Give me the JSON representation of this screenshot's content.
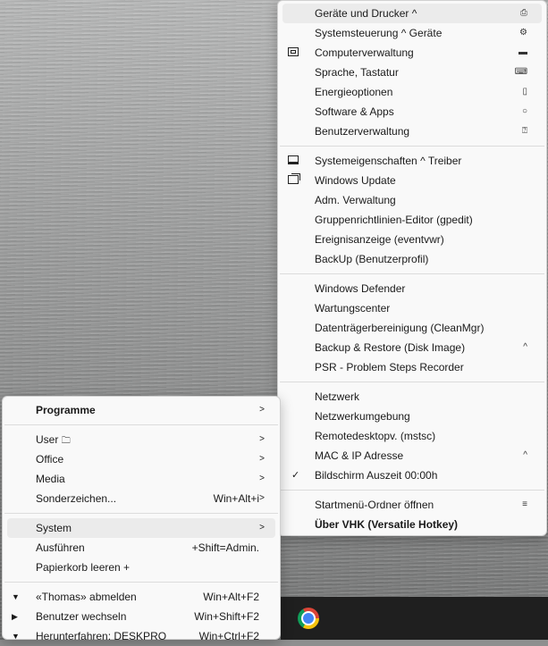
{
  "right_menu": {
    "group1": [
      {
        "label": "Geräte und Drucker ^",
        "icon": "printer-icon",
        "highlighted": true
      },
      {
        "label": "Systemsteuerung ^ Geräte",
        "icon": "gear-icon"
      },
      {
        "label": "Computerverwaltung",
        "icon": "computer-icon",
        "left_icon": "window-icon"
      },
      {
        "label": "Sprache, Tastatur",
        "icon": "keyboard-icon"
      },
      {
        "label": "Energieoptionen",
        "icon": "battery-icon"
      },
      {
        "label": "Software & Apps",
        "icon": "circle-icon"
      },
      {
        "label": "Benutzerverwaltung",
        "icon": "user-card-icon"
      }
    ],
    "group2": [
      {
        "label": "Systemeigenschaften ^ Treiber",
        "left_icon": "minimized-window-icon"
      },
      {
        "label": "Windows Update",
        "left_icon": "restore-window-icon"
      },
      {
        "label": "Adm. Verwaltung"
      },
      {
        "label": "Gruppenrichtlinien-Editor (gpedit)"
      },
      {
        "label": "Ereignisanzeige (eventvwr)"
      },
      {
        "label": "BackUp (Benutzerprofil)"
      }
    ],
    "group3": [
      {
        "label": "Windows Defender"
      },
      {
        "label": "Wartungscenter"
      },
      {
        "label": "Datenträgerbereinigung (CleanMgr)"
      },
      {
        "label": "Backup & Restore (Disk Image)",
        "suffix": "^"
      },
      {
        "label": "PSR - Problem Steps Recorder"
      }
    ],
    "group4": [
      {
        "label": "Netzwerk"
      },
      {
        "label": "Netzwerkumgebung"
      },
      {
        "label": "Remotedesktopv. (mstsc)"
      },
      {
        "label": "MAC & IP Adresse",
        "suffix": "^"
      },
      {
        "label": "Bildschirm Auszeit 00:00h",
        "checked": true
      }
    ],
    "group5": [
      {
        "label": "Startmenü-Ordner öffnen",
        "icon": "hamburger-icon"
      },
      {
        "label": "Über VHK (Versatile Hotkey)",
        "bold": true
      }
    ]
  },
  "left_menu": {
    "programme": {
      "label": "Programme"
    },
    "user": {
      "label": "User",
      "folder_icon": "folder-icon"
    },
    "office": {
      "label": "Office"
    },
    "media": {
      "label": "Media"
    },
    "sonderzeichen": {
      "label": "Sonderzeichen...",
      "shortcut": "Win+Alt+i"
    },
    "system": {
      "label": "System"
    },
    "ausfuehren": {
      "label": "Ausführen",
      "shortcut": "+Shift=Admin."
    },
    "papierkorb": {
      "label": "Papierkorb leeren +"
    },
    "abmelden": {
      "label": "«Thomas» abmelden",
      "shortcut": "Win+Alt+F2"
    },
    "wechseln": {
      "label": "Benutzer wechseln",
      "shortcut": "Win+Shift+F2"
    },
    "herunterfahren": {
      "label": "Herunterfahren: DESKPRO",
      "shortcut": "Win+Ctrl+F2"
    }
  },
  "symbols": {
    "submenu_arrow": ">",
    "check": "✓",
    "tri_down": "▼",
    "tri_right": "▶",
    "printer": "⎙",
    "gear": "⚙",
    "pc": "▬",
    "keyboard": "⌨",
    "battery": "▯",
    "circle": "○",
    "usercard": "⍰",
    "hamburger": "≡",
    "folder": "🗀"
  }
}
